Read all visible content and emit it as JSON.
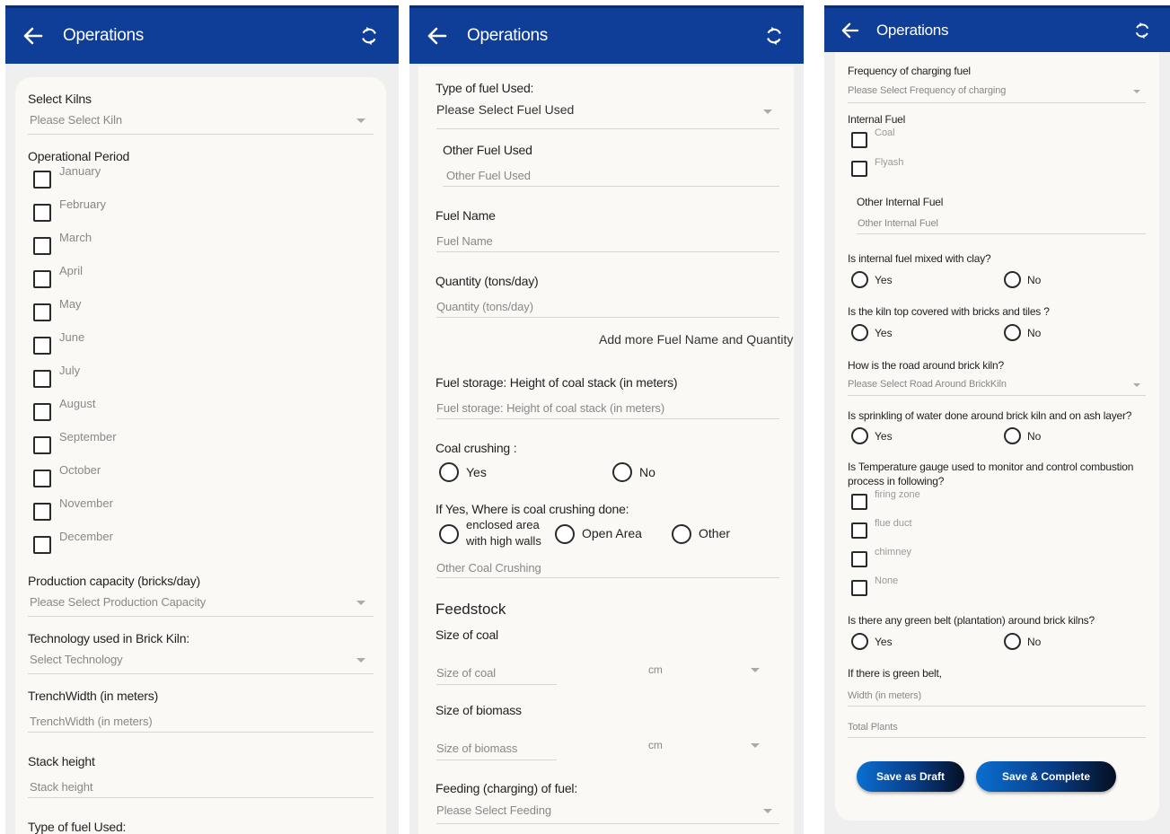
{
  "screen1": {
    "title": "Operations",
    "select_kilns": {
      "label": "Select Kilns",
      "placeholder": "Please Select Kiln"
    },
    "operational_period": {
      "label": "Operational Period",
      "months": [
        "January",
        "February",
        "March",
        "April",
        "May",
        "June",
        "July",
        "August",
        "September",
        "October",
        "November",
        "December"
      ]
    },
    "production_capacity": {
      "label": "Production capacity (bricks/day)",
      "placeholder": "Please Select Production Capacity"
    },
    "technology": {
      "label": "Technology used in Brick Kiln:",
      "placeholder": "Select Technology"
    },
    "trench_width": {
      "label": "TrenchWidth (in meters)",
      "placeholder": "TrenchWidth (in meters)"
    },
    "stack_height": {
      "label": "Stack height",
      "placeholder": "Stack height"
    },
    "fuel_type_label": "Type of fuel Used:"
  },
  "screen2": {
    "title": "Operations",
    "fuel_type": {
      "label": "Type of fuel Used:",
      "placeholder": "Please Select Fuel Used"
    },
    "other_fuel": {
      "label": "Other Fuel Used",
      "placeholder": "Other Fuel Used"
    },
    "fuel_name": {
      "label": "Fuel Name",
      "placeholder": "Fuel Name"
    },
    "quantity": {
      "label": "Quantity (tons/day)",
      "placeholder": "Quantity (tons/day)"
    },
    "add_more": "Add more Fuel Name and Quantity",
    "fuel_storage": {
      "label": "Fuel storage: Height of coal stack (in meters)",
      "placeholder": "Fuel storage: Height of coal stack (in meters)"
    },
    "coal_crushing": {
      "label": "Coal crushing :",
      "yes": "Yes",
      "no": "No"
    },
    "crushing_place": {
      "label": "If Yes, Where is coal crushing done:",
      "opt1_line1": "enclosed area",
      "opt1_line2": "with high walls",
      "opt2": "Open Area",
      "opt3": "Other"
    },
    "other_crushing_placeholder": "Other Coal Crushing",
    "feedstock_title": "Feedstock",
    "size_coal": {
      "label": "Size of coal",
      "placeholder": "Size of coal",
      "unit": "cm"
    },
    "size_biomass": {
      "label": "Size of biomass",
      "placeholder": "Size of biomass",
      "unit": "cm"
    },
    "feeding": {
      "label": "Feeding (charging) of fuel:",
      "placeholder": "Please Select Feeding"
    }
  },
  "screen3": {
    "title": "Operations",
    "frequency": {
      "label": "Frequency of charging fuel",
      "placeholder": "Please Select Frequency of charging"
    },
    "internal_fuel": {
      "label": "Internal Fuel",
      "options": [
        "Coal",
        "Flyash"
      ]
    },
    "other_internal": {
      "label": "Other Internal Fuel",
      "placeholder": "Other Internal Fuel"
    },
    "q_mixed": {
      "label": "Is internal fuel mixed with clay?",
      "yes": "Yes",
      "no": "No"
    },
    "q_covered": {
      "label": "Is the kiln top covered with bricks and tiles ?",
      "yes": "Yes",
      "no": "No"
    },
    "road": {
      "label": "How is the road around brick kiln?",
      "placeholder": "Please Select Road Around BrickKiln"
    },
    "q_sprinkling": {
      "label": "Is sprinkling of water done around brick kiln and on ash layer?",
      "yes": "Yes",
      "no": "No"
    },
    "temp_gauge": {
      "label_line1": "Is Temperature gauge used to monitor and control combustion",
      "label_line2": "process in following?",
      "options": [
        "firing zone",
        "flue duct",
        "chimney",
        "None"
      ]
    },
    "q_greenbelt": {
      "label": "Is there any green belt (plantation) around brick kilns?",
      "yes": "Yes",
      "no": "No"
    },
    "greenbelt_detail": {
      "label": "If there is green belt,",
      "width_placeholder": "Width (in meters)",
      "plants_placeholder": "Total Plants"
    },
    "save_draft": "Save as Draft",
    "save_complete": "Save & Complete"
  }
}
